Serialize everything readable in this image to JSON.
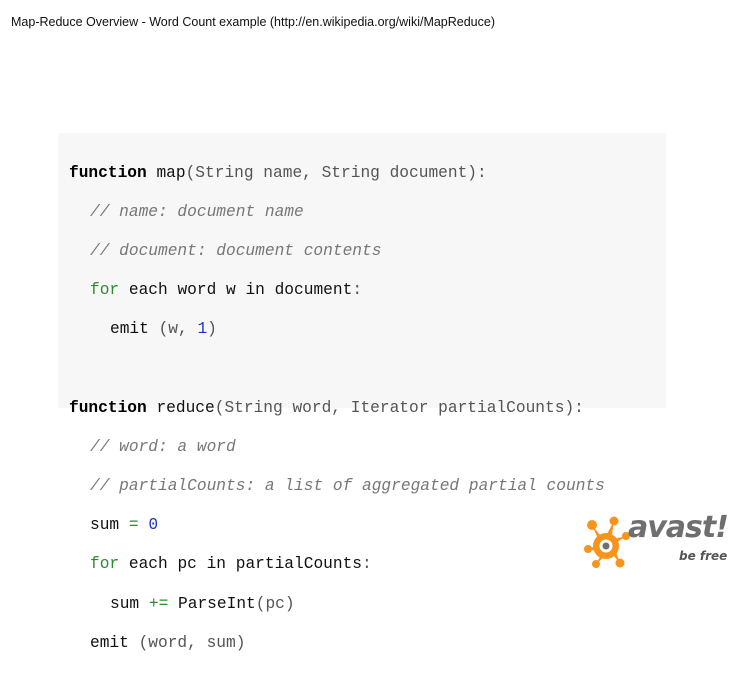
{
  "header": {
    "title": "Map-Reduce Overview - Word Count example (http://en.wikipedia.org/wiki/MapReduce)"
  },
  "code": {
    "map_kw": "function",
    "map_sig": "map",
    "map_params": "(String name, String document)",
    "map_colon": ":",
    "map_comment1": "// name: document name",
    "map_comment2": "// document: document contents",
    "map_for": "for",
    "map_loop": "each word w in document",
    "map_loop_colon": ":",
    "map_emit": "emit",
    "map_emit_open": "(w,",
    "map_emit_num": "1",
    "map_emit_close": ")",
    "reduce_kw": "function",
    "reduce_sig": "reduce",
    "reduce_params": "(String word, Iterator partialCounts)",
    "reduce_colon": ":",
    "reduce_comment1": "// word: a word",
    "reduce_comment2": "// partialCounts: a list of aggregated partial counts",
    "reduce_sum": "sum",
    "reduce_eq": "=",
    "reduce_zero": "0",
    "reduce_for": "for",
    "reduce_loop": "each pc in partialCounts",
    "reduce_loop_colon": ":",
    "reduce_sum2": "sum",
    "reduce_pluseq": "+=",
    "reduce_parse": "ParseInt",
    "reduce_parse_arg": "(pc)",
    "reduce_emit": "emit",
    "reduce_emit_args": "(word, sum)"
  },
  "logo": {
    "word": "avast!",
    "tagline": "be free",
    "brand_color": "#f7941d",
    "text_color": "#6f6f6f"
  }
}
